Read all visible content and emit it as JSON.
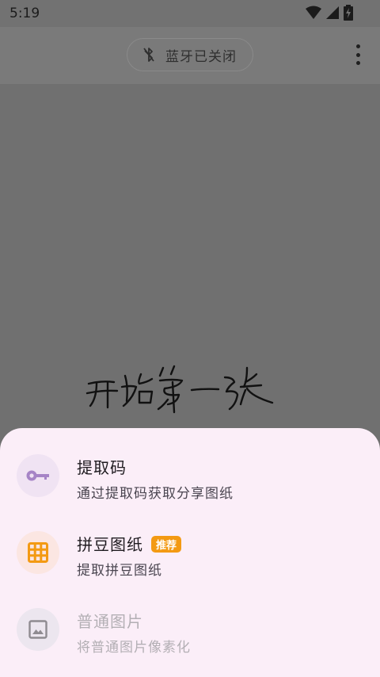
{
  "status_bar": {
    "time": "5:19",
    "icons": [
      "wifi-icon",
      "cellular-signal-icon",
      "battery-charging-icon"
    ]
  },
  "app_bar": {
    "bluetooth_chip_label": "蓝牙已关闭",
    "bluetooth_icon": "bluetooth-disabled-icon",
    "more_icon": "more-vertical-icon"
  },
  "canvas": {
    "handwriting_text": "开始第一张"
  },
  "sheet": {
    "items": [
      {
        "title": "提取码",
        "subtitle": "通过提取码获取分享图纸",
        "icon": "key-icon",
        "icon_color": "#a684c6",
        "icon_bg": "#f0e3f3",
        "enabled": true
      },
      {
        "title": "拼豆图纸",
        "badge": "推荐",
        "subtitle": "提取拼豆图纸",
        "icon": "grid-icon",
        "icon_color": "#f39a13",
        "icon_bg": "#fbe6e2",
        "enabled": true
      },
      {
        "title": "普通图片",
        "subtitle": "将普通图片像素化",
        "icon": "image-icon",
        "icon_color": "#8f8b91",
        "icon_bg": "#ece6ef",
        "enabled": false
      }
    ]
  },
  "colors": {
    "scrim": "#707070",
    "sheet_bg": "#fbeef8",
    "badge_bg": "#f39a13"
  }
}
